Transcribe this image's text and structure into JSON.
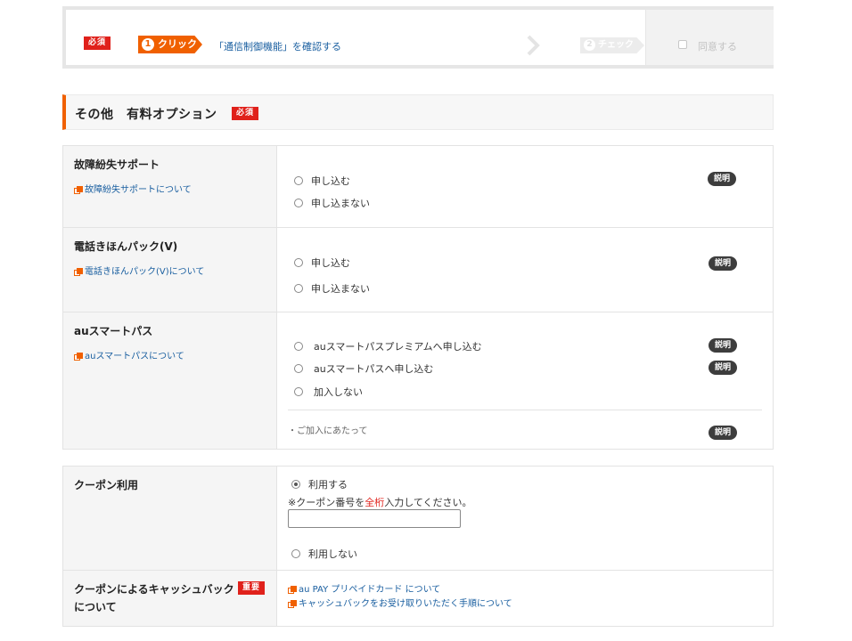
{
  "stepbar": {
    "required_badge": "必須",
    "step1_num": "1",
    "step1_label": "クリック",
    "step1_text": "「通信制御機能」を確認する",
    "step2_num": "2",
    "step2_label": "チェック",
    "agree_label": "同意する"
  },
  "section": {
    "title": "その他　有料オプション",
    "required_badge": "必須"
  },
  "options": [
    {
      "name": "故障紛失サポート",
      "link": "故障紛失サポートについて",
      "choices": [
        "申し込む",
        "申し込まない"
      ],
      "explain": "説明"
    },
    {
      "name": "電話きほんパック(V)",
      "link": "電話きほんパック(V)について",
      "choices": [
        "申し込む",
        "申し込まない"
      ],
      "explain": "説明"
    },
    {
      "name": "auスマートパス",
      "link": "auスマートパスについて",
      "choices": [
        "auスマートパスプレミアムへ申し込む",
        "auスマートパスへ申し込む",
        "加入しない"
      ],
      "explain": "説明",
      "note": "・ご加入にあたって"
    }
  ],
  "coupon": {
    "name": "クーポン利用",
    "use_label": "利用する",
    "note_before": "※クーポン番号を",
    "note_red": "全桁",
    "note_after": "入力してください。",
    "input_value": "",
    "no_use_label": "利用しない"
  },
  "cashback": {
    "name_line1": "クーポンによるキャッシュバック",
    "name_line2": "について",
    "badge": "重要",
    "links": [
      "au PAY プリペイドカード について",
      "キャッシュバックをお受け取りいただく手順について"
    ]
  },
  "colors": {
    "accent": "#f06000",
    "required_red": "#e0211b",
    "link_blue": "#1a5fa0",
    "explain_pill": "#3d3d3d"
  }
}
